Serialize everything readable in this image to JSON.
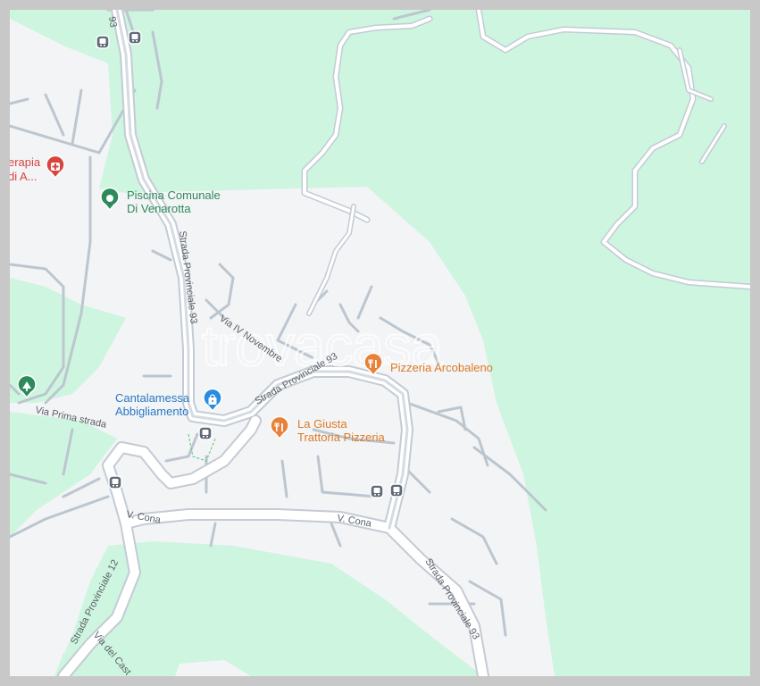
{
  "watermark": "trovacasa",
  "colors": {
    "park": "#cef5df",
    "urban": "#f3f4f6",
    "road_fill": "#ffffff",
    "road_stroke": "#c3cbd4",
    "minor_road": "#bcc6cf",
    "frame": "#c8c8c8"
  },
  "roads": {
    "sp93_vertical": "Strada Provinciale 93",
    "sp93_top": "93",
    "sp93_middle": "Strada Provinciale 93",
    "sp93_south": "Strada Provinciale 93",
    "sp12": "Strada Provinciale 12",
    "via_iv_novembre": "Via IV Novembre",
    "via_prima_strada": "Via Prima strada",
    "v_cona_west": "V. Cona",
    "v_cona_east": "V. Cona",
    "via_del_cast": "Via del Cast"
  },
  "pois": {
    "piscina_line1": "Piscina Comunale",
    "piscina_line2": "Di Venarotta",
    "terapia_line1": "erapia",
    "terapia_line2": "di A...",
    "pizzeria_arcobaleno": "Pizzeria Arcobaleno",
    "cantalamessa_line1": "Cantalamessa",
    "cantalamessa_line2": "Abbigliamento",
    "la_giusta_line1": "La Giusta",
    "la_giusta_line2": "Trattoria Pizzeria"
  },
  "icons": {
    "bus_stop": "bus-stop-icon",
    "park": "tree-icon",
    "hospital": "hospital-icon",
    "restaurant": "fork-knife-icon",
    "shop": "shopping-bag-icon",
    "pool": "place-marker-icon"
  }
}
